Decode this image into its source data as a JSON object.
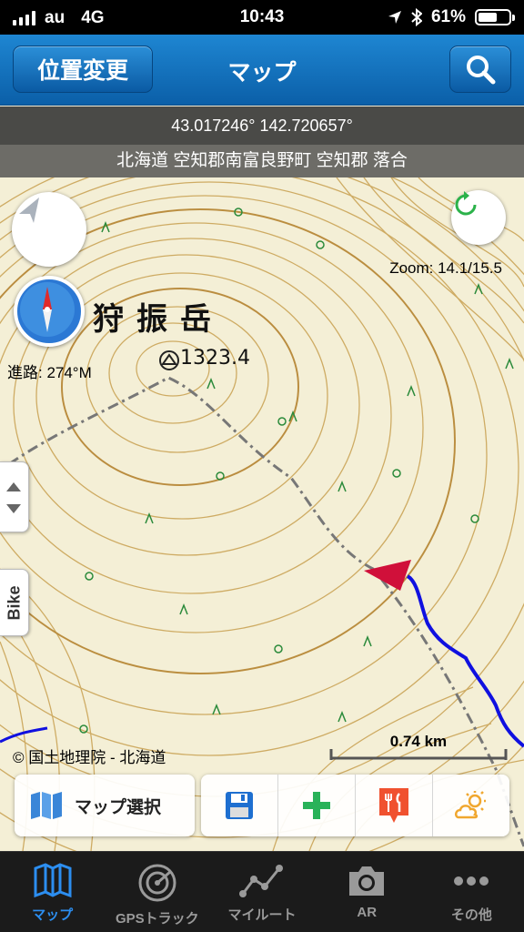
{
  "status_bar": {
    "carrier": "au",
    "network": "4G",
    "time": "10:43",
    "battery": "61%",
    "battery_level": 0.61,
    "icons": [
      "location-arrow-icon",
      "bluetooth-icon",
      "battery-icon"
    ]
  },
  "nav": {
    "left_button": "位置変更",
    "title": "マップ",
    "right_icon": "search-icon"
  },
  "info": {
    "coordinates": "43.017246° 142.720657°",
    "address": "北海道 空知郡南富良野町 空知郡 落合"
  },
  "map": {
    "peak_name": "狩振岳",
    "elevation": "1323.4",
    "heading": "進路: 274°M",
    "zoom": "Zoom: 14.1/15.5",
    "scale": "0.74 km",
    "copyright": "© 国土地理院 - 北海道",
    "side_tab": "Bike",
    "colors": {
      "track": "#1010e0",
      "arrow": "#d0103a",
      "contour": "#c8a050",
      "trail": "#777777"
    }
  },
  "tools": {
    "map_select": "マップ選択",
    "icons": [
      "save-icon",
      "add-icon",
      "restaurant-icon",
      "weather-icon"
    ]
  },
  "tabs": [
    {
      "label": "マップ",
      "icon": "map-icon",
      "active": true
    },
    {
      "label": "GPSトラック",
      "icon": "radar-icon",
      "active": false
    },
    {
      "label": "マイルート",
      "icon": "route-icon",
      "active": false
    },
    {
      "label": "AR",
      "icon": "camera-icon",
      "active": false
    },
    {
      "label": "その他",
      "icon": "more-icon",
      "active": false
    }
  ]
}
